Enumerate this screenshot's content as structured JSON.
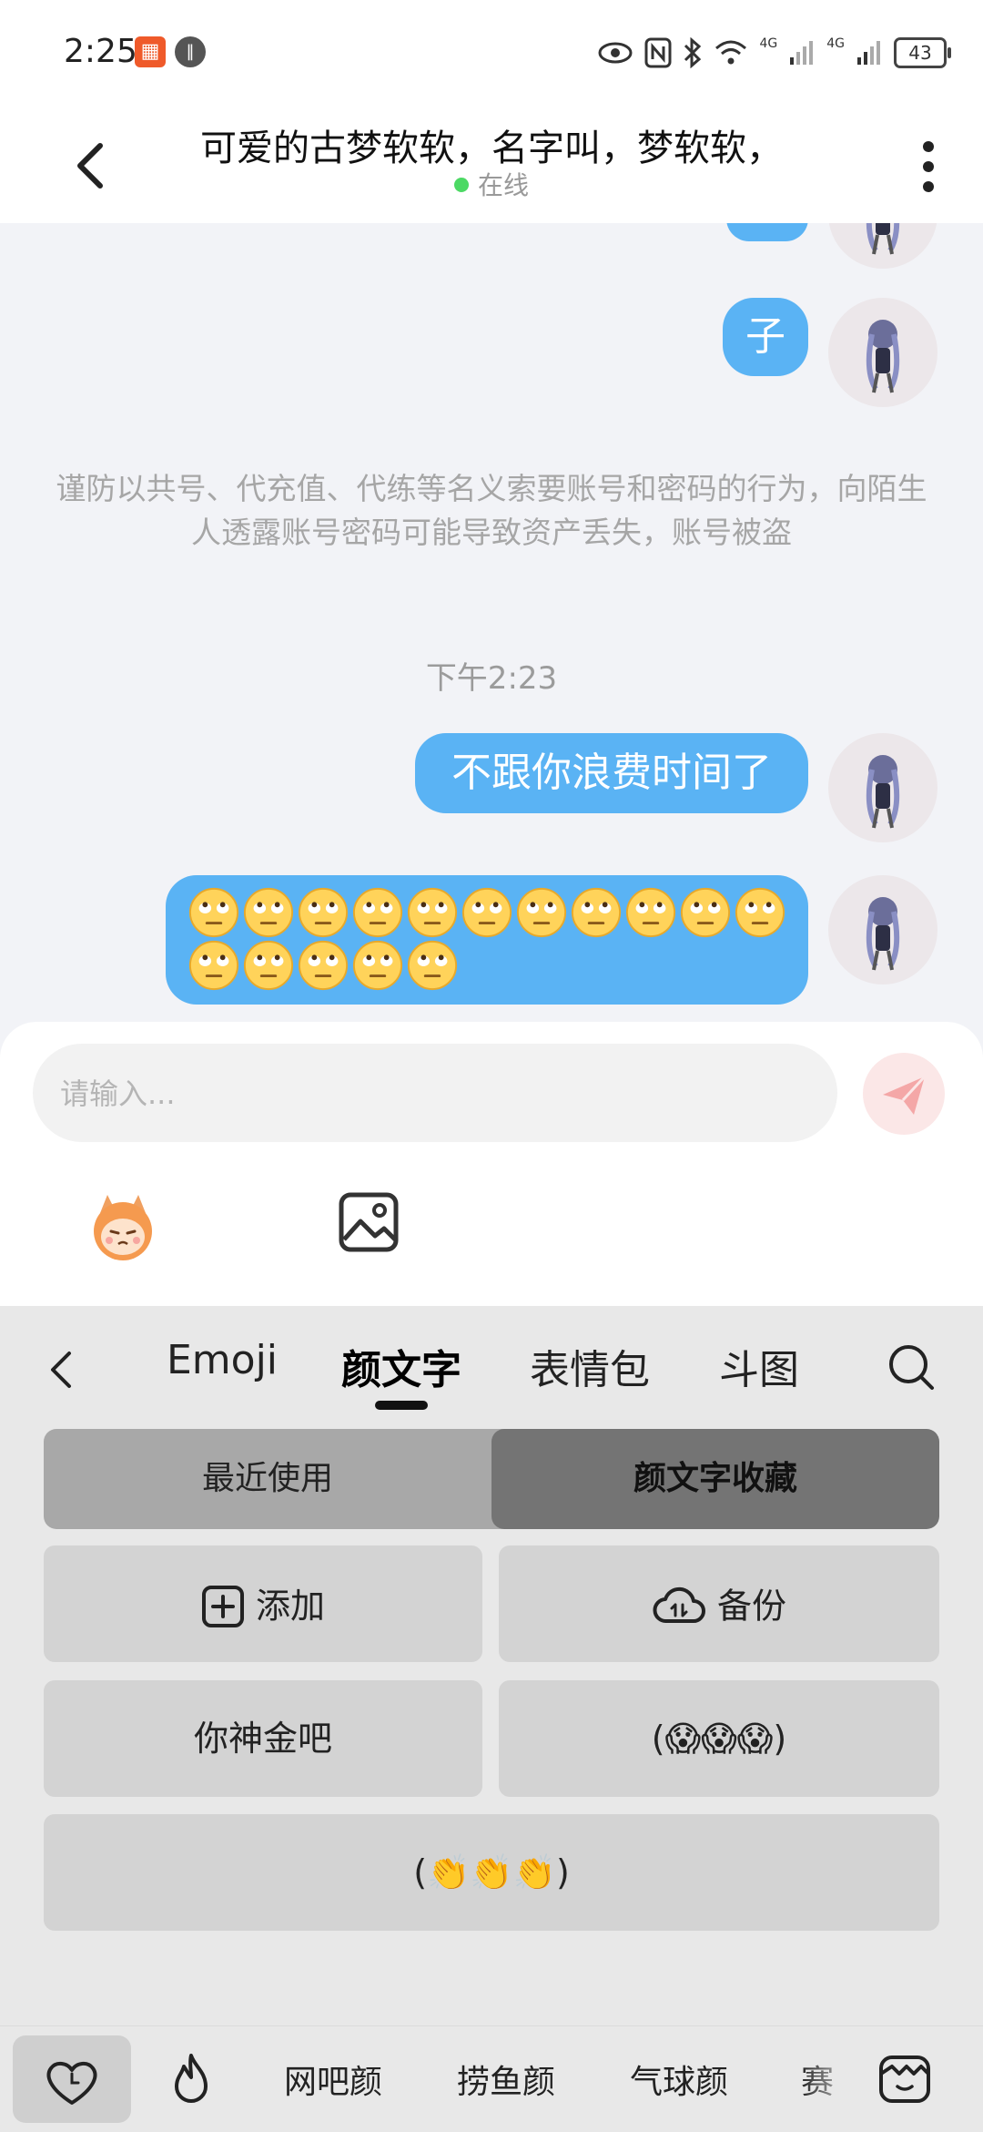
{
  "status_bar": {
    "time": "2:25",
    "net1": "4G",
    "net2": "4G",
    "battery": "43"
  },
  "header": {
    "title": "可爱的古梦软软，名字叫，梦软软，",
    "status": "在线"
  },
  "chat": {
    "messages": [
      {
        "type": "text",
        "text": "子"
      },
      {
        "type": "text",
        "text": "不跟你浪费时间了"
      },
      {
        "type": "emoji",
        "emoji_name": "face-with-rolling-eyes",
        "count": 16
      }
    ],
    "notice": "谨防以共号、代充值、代练等名义索要账号和密码的行为，向陌生人透露账号密码可能导致资产丢失，账号被盗",
    "timestamp": "下午2:23"
  },
  "composer": {
    "placeholder": "请输入..."
  },
  "panel": {
    "tabs": [
      "Emoji",
      "颜文字",
      "表情包",
      "斗图"
    ],
    "active_tab": "颜文字",
    "segments": [
      "最近使用",
      "颜文字收藏"
    ],
    "active_segment": "颜文字收藏",
    "add_label": "添加",
    "backup_label": "备份",
    "items": [
      "你神金吧",
      "(😱😱😱)",
      "(👏👏👏)"
    ]
  },
  "categories": {
    "labels": [
      "网吧颜",
      "捞鱼颜",
      "气球颜",
      "赛"
    ]
  },
  "colors": {
    "bubble": "#5ab3f4",
    "online": "#4cd964",
    "panel_bg": "#e8e8e8"
  }
}
